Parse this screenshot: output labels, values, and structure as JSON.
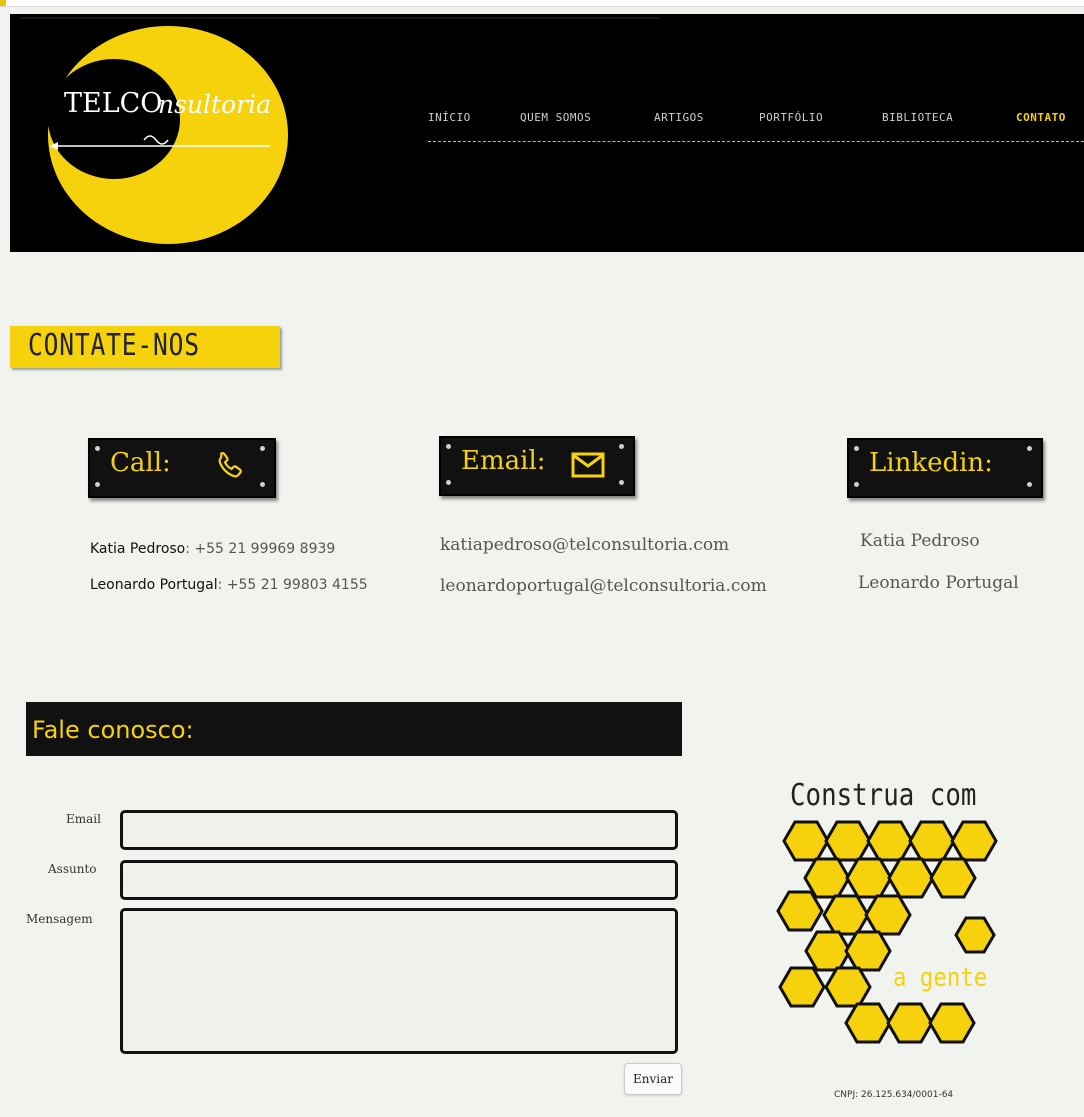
{
  "header": {
    "logo": {
      "left_text": "TELCO",
      "right_text": "nsultoria"
    },
    "nav": [
      {
        "label": "INÍCIO",
        "active": false
      },
      {
        "label": "QUEM SOMOS",
        "active": false
      },
      {
        "label": "ARTIGOS",
        "active": false
      },
      {
        "label": "PORTFÓLIO",
        "active": false
      },
      {
        "label": "BIBLIOTECA",
        "active": false
      },
      {
        "label": "CONTATO",
        "active": true
      }
    ]
  },
  "page": {
    "title": "CONTATE-NOS"
  },
  "contact": {
    "call": {
      "label": "Call:",
      "icon": "phone-icon",
      "entries": [
        {
          "name": "Katia Pedroso",
          "value": ": +55 21 99969 8939"
        },
        {
          "name": "Leonardo Portugal",
          "value": ": +55 21 99803 4155"
        }
      ]
    },
    "email": {
      "label": "Email:",
      "icon": "envelope-icon",
      "entries": [
        "katiapedroso@telconsultoria.com",
        "leonardoportugal@telconsultoria.com"
      ]
    },
    "linkedin": {
      "label": "Linkedin:",
      "entries": [
        "Katia Pedroso",
        "Leonardo Portugal"
      ]
    }
  },
  "form": {
    "heading": "Fale conosco:",
    "email_label": "Email",
    "email_value": "",
    "subject_label": "Assunto",
    "subject_value": "",
    "message_label": "Mensagem",
    "message_value": "",
    "submit_label": "Enviar"
  },
  "promo": {
    "line1": "Construa com",
    "line2": "a gente",
    "image": "honeycomb-logo"
  },
  "footer": {
    "cnpj": "CNPJ: 26.125.634/0001-64"
  },
  "colors": {
    "accent": "#f5d20c",
    "dark": "#111111",
    "background": "#f1f3ef"
  }
}
